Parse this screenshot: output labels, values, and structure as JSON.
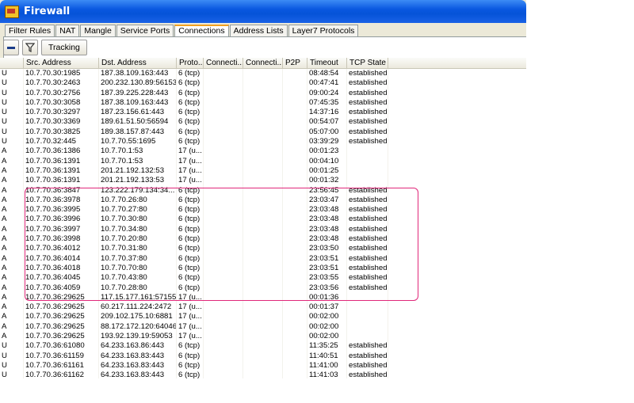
{
  "window": {
    "title": "Firewall"
  },
  "tabs": [
    "Filter Rules",
    "NAT",
    "Mangle",
    "Service Ports",
    "Connections",
    "Address Lists",
    "Layer7 Protocols"
  ],
  "active_tab": "Connections",
  "toolbar": {
    "tracking_label": "Tracking"
  },
  "columns": [
    "",
    "Src. Address",
    "Dst. Address",
    "Proto...",
    "Connecti...",
    "Connecti...",
    "P2P",
    "Timeout",
    "TCP State"
  ],
  "rows": [
    [
      "U",
      "10.7.70.30:1985",
      "187.38.109.163:443",
      "6 (tcp)",
      "",
      "",
      "",
      "08:48:54",
      "established"
    ],
    [
      "U",
      "10.7.70.30:2463",
      "200.232.130.89:56153",
      "6 (tcp)",
      "",
      "",
      "",
      "00:47:41",
      "established"
    ],
    [
      "U",
      "10.7.70.30:2756",
      "187.39.225.228:443",
      "6 (tcp)",
      "",
      "",
      "",
      "09:00:24",
      "established"
    ],
    [
      "U",
      "10.7.70.30:3058",
      "187.38.109.163:443",
      "6 (tcp)",
      "",
      "",
      "",
      "07:45:35",
      "established"
    ],
    [
      "U",
      "10.7.70.30:3297",
      "187.23.156.61:443",
      "6 (tcp)",
      "",
      "",
      "",
      "14:37:16",
      "established"
    ],
    [
      "U",
      "10.7.70.30:3369",
      "189.61.51.50:56594",
      "6 (tcp)",
      "",
      "",
      "",
      "00:54:07",
      "established"
    ],
    [
      "U",
      "10.7.70.30:3825",
      "189.38.157.87:443",
      "6 (tcp)",
      "",
      "",
      "",
      "05:07:00",
      "established"
    ],
    [
      "U",
      "10.7.70.32:445",
      "10.7.70.55:1695",
      "6 (tcp)",
      "",
      "",
      "",
      "03:39:29",
      "established"
    ],
    [
      "A",
      "10.7.70.36:1386",
      "10.7.70.1:53",
      "17 (u...",
      "",
      "",
      "",
      "00:01:23",
      ""
    ],
    [
      "A",
      "10.7.70.36:1391",
      "10.7.70.1:53",
      "17 (u...",
      "",
      "",
      "",
      "00:04:10",
      ""
    ],
    [
      "A",
      "10.7.70.36:1391",
      "201.21.192.132:53",
      "17 (u...",
      "",
      "",
      "",
      "00:01:25",
      ""
    ],
    [
      "A",
      "10.7.70.36:1391",
      "201.21.192.133:53",
      "17 (u...",
      "",
      "",
      "",
      "00:01:32",
      ""
    ],
    [
      "A",
      "10.7.70.36:3847",
      "123.222.179.134:34...",
      "6 (tcp)",
      "",
      "",
      "",
      "23:56:45",
      "established"
    ],
    [
      "A",
      "10.7.70.36:3978",
      "10.7.70.26:80",
      "6 (tcp)",
      "",
      "",
      "",
      "23:03:47",
      "established"
    ],
    [
      "A",
      "10.7.70.36:3995",
      "10.7.70.27:80",
      "6 (tcp)",
      "",
      "",
      "",
      "23:03:48",
      "established"
    ],
    [
      "A",
      "10.7.70.36:3996",
      "10.7.70.30:80",
      "6 (tcp)",
      "",
      "",
      "",
      "23:03:48",
      "established"
    ],
    [
      "A",
      "10.7.70.36:3997",
      "10.7.70.34:80",
      "6 (tcp)",
      "",
      "",
      "",
      "23:03:48",
      "established"
    ],
    [
      "A",
      "10.7.70.36:3998",
      "10.7.70.20:80",
      "6 (tcp)",
      "",
      "",
      "",
      "23:03:48",
      "established"
    ],
    [
      "A",
      "10.7.70.36:4012",
      "10.7.70.31:80",
      "6 (tcp)",
      "",
      "",
      "",
      "23:03:50",
      "established"
    ],
    [
      "A",
      "10.7.70.36:4014",
      "10.7.70.37:80",
      "6 (tcp)",
      "",
      "",
      "",
      "23:03:51",
      "established"
    ],
    [
      "A",
      "10.7.70.36:4018",
      "10.7.70.70:80",
      "6 (tcp)",
      "",
      "",
      "",
      "23:03:51",
      "established"
    ],
    [
      "A",
      "10.7.70.36:4045",
      "10.7.70.43:80",
      "6 (tcp)",
      "",
      "",
      "",
      "23:03:55",
      "established"
    ],
    [
      "A",
      "10.7.70.36:4059",
      "10.7.70.28:80",
      "6 (tcp)",
      "",
      "",
      "",
      "23:03:56",
      "established"
    ],
    [
      "A",
      "10.7.70.36:29625",
      "117.15.177.161:57155",
      "17 (u...",
      "",
      "",
      "",
      "00:01:36",
      ""
    ],
    [
      "A",
      "10.7.70.36:29625",
      "60.217.111.224:2472",
      "17 (u...",
      "",
      "",
      "",
      "00:01:37",
      ""
    ],
    [
      "A",
      "10.7.70.36:29625",
      "209.102.175.10:6881",
      "17 (u...",
      "",
      "",
      "",
      "00:02:00",
      ""
    ],
    [
      "A",
      "10.7.70.36:29625",
      "88.172.172.120:64046",
      "17 (u...",
      "",
      "",
      "",
      "00:02:00",
      ""
    ],
    [
      "A",
      "10.7.70.36:29625",
      "193.92.139.19:59053",
      "17 (u...",
      "",
      "",
      "",
      "00:02:00",
      ""
    ],
    [
      "U",
      "10.7.70.36:61080",
      "64.233.163.86:443",
      "6 (tcp)",
      "",
      "",
      "",
      "11:35:25",
      "established"
    ],
    [
      "U",
      "10.7.70.36:61159",
      "64.233.163.83:443",
      "6 (tcp)",
      "",
      "",
      "",
      "11:40:51",
      "established"
    ],
    [
      "U",
      "10.7.70.36:61161",
      "64.233.163.83:443",
      "6 (tcp)",
      "",
      "",
      "",
      "11:41:00",
      "established"
    ],
    [
      "U",
      "10.7.70.36:61162",
      "64.233.163.83:443",
      "6 (tcp)",
      "",
      "",
      "",
      "11:41:03",
      "established"
    ]
  ],
  "highlight": {
    "color": "#e0287a"
  }
}
